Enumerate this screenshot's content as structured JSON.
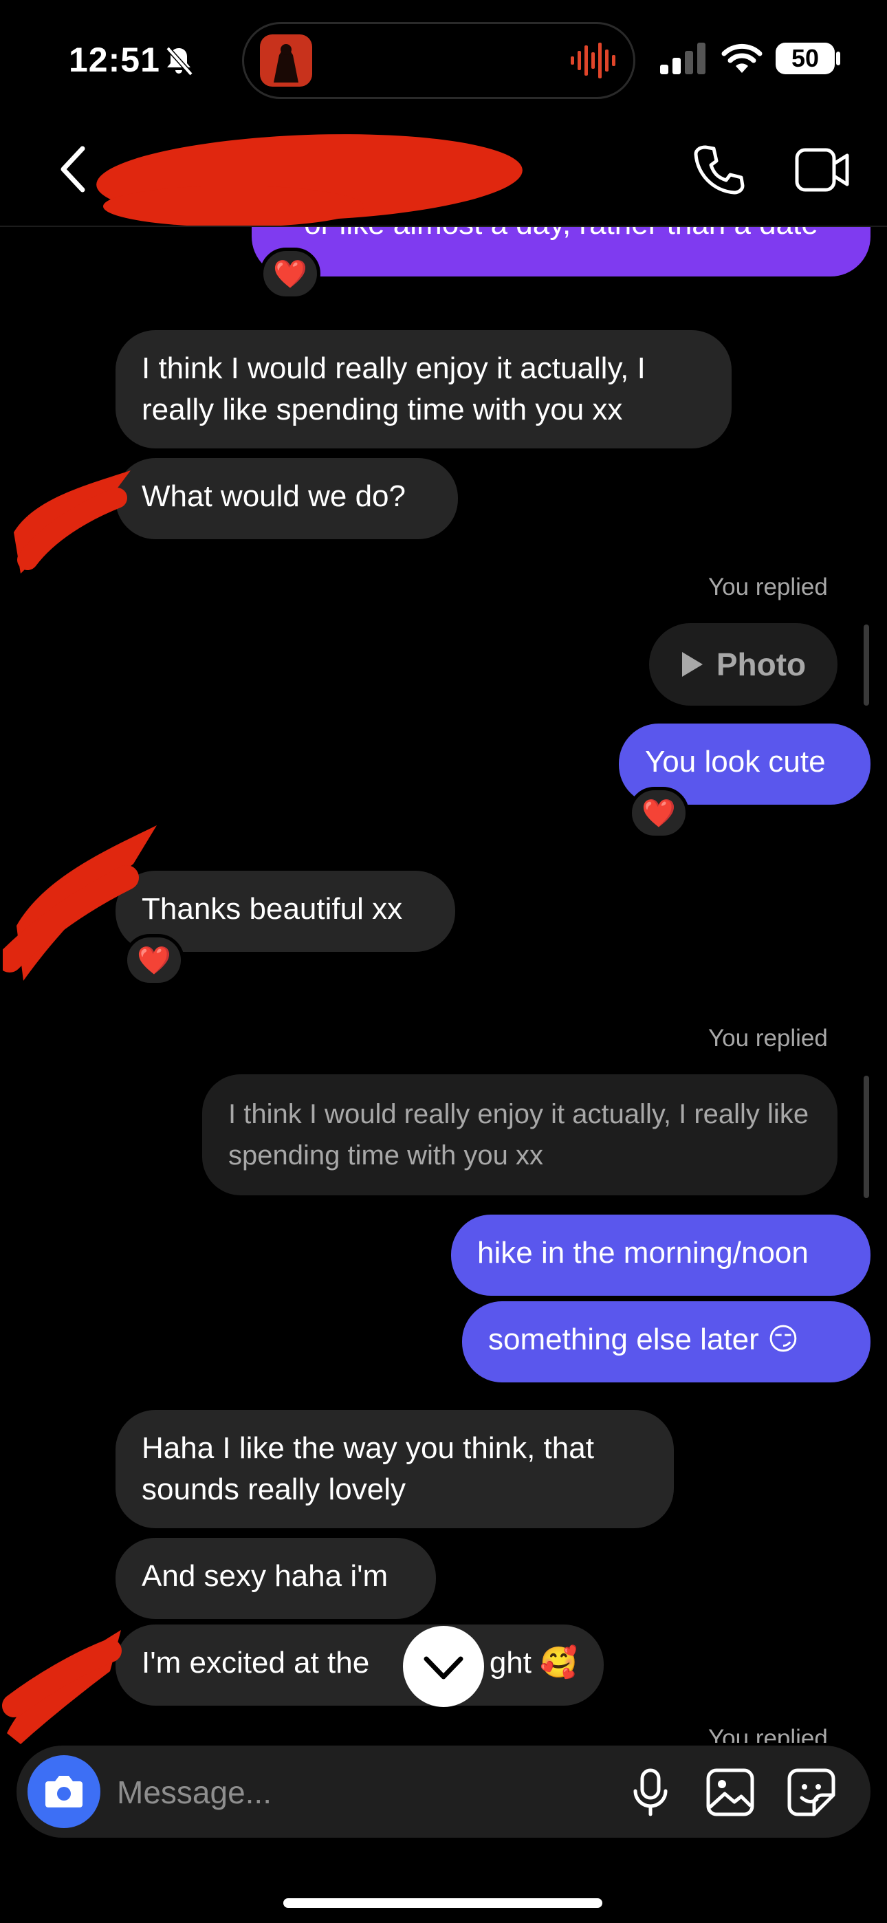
{
  "status_bar": {
    "time": "12:51",
    "battery": "50",
    "icons": [
      "bell-slash-icon",
      "signal-icon",
      "wifi-icon",
      "battery-icon"
    ]
  },
  "header": {
    "icons": [
      "back-icon",
      "phone-icon",
      "video-icon"
    ]
  },
  "messages": {
    "top_partial": "or like almost a day, rather than a date",
    "m1": "I think I would really enjoy it actually, I really like spending time with you xx",
    "m2": "What would we do?",
    "replied_label_1": "You replied",
    "photo_label": "Photo",
    "m3": "You look cute",
    "m4": "Thanks beautiful xx",
    "replied_label_2": "You replied",
    "quoted": "I think I would really enjoy it actually, I really like spending time with you xx",
    "m5": "hike in the morning/noon",
    "m6": "something else later 😏",
    "m7": "Haha I like the way you think, that sounds really lovely",
    "m8": "And sexy haha i'm",
    "m9a": "I'm excited at the",
    "m9b": "ght 🥰",
    "bottom_partial": "You replied"
  },
  "reactions": {
    "heart": "❤️"
  },
  "composer": {
    "placeholder": "Message...",
    "icons": [
      "camera-icon",
      "mic-icon",
      "gallery-icon",
      "sticker-icon"
    ]
  },
  "colors": {
    "outgoing_bubble": "#5a57ed",
    "outgoing_bubble_top": "#7f3bf0",
    "incoming_bubble": "#262626",
    "redaction": "#e0270f",
    "camera_button": "#3d6ff5"
  }
}
